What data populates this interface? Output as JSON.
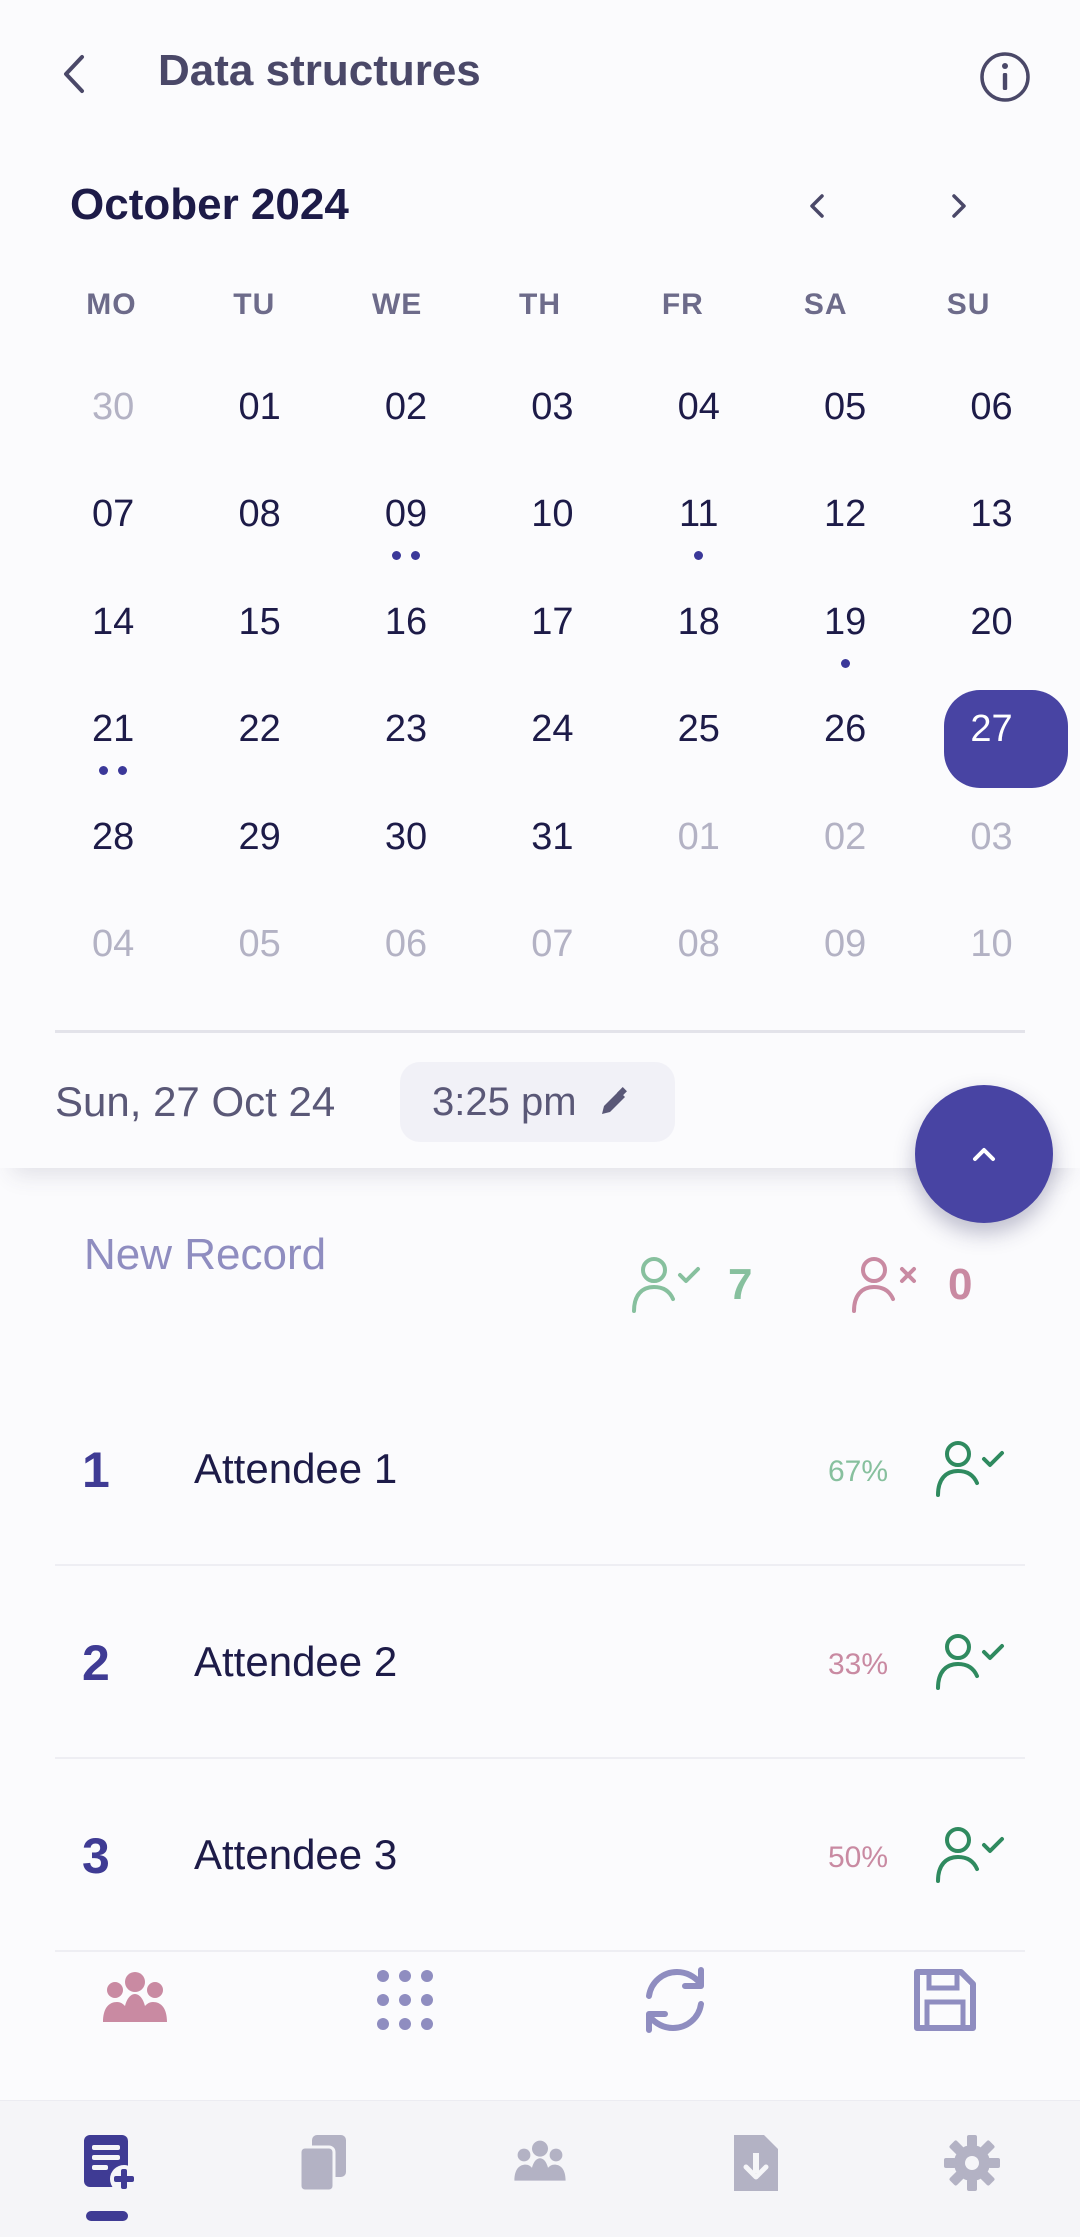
{
  "header": {
    "title": "Data structures"
  },
  "calendar": {
    "month_label": "October 2024",
    "weekdays": [
      "MO",
      "TU",
      "WE",
      "TH",
      "FR",
      "SA",
      "SU"
    ],
    "weeks": [
      [
        {
          "d": "30",
          "other": true
        },
        {
          "d": "01"
        },
        {
          "d": "02"
        },
        {
          "d": "03"
        },
        {
          "d": "04"
        },
        {
          "d": "05"
        },
        {
          "d": "06"
        }
      ],
      [
        {
          "d": "07"
        },
        {
          "d": "08"
        },
        {
          "d": "09",
          "dots": 2
        },
        {
          "d": "10"
        },
        {
          "d": "11",
          "dots": 1
        },
        {
          "d": "12"
        },
        {
          "d": "13"
        }
      ],
      [
        {
          "d": "14"
        },
        {
          "d": "15"
        },
        {
          "d": "16"
        },
        {
          "d": "17"
        },
        {
          "d": "18"
        },
        {
          "d": "19",
          "dots": 1
        },
        {
          "d": "20"
        }
      ],
      [
        {
          "d": "21",
          "dots": 2
        },
        {
          "d": "22"
        },
        {
          "d": "23"
        },
        {
          "d": "24"
        },
        {
          "d": "25"
        },
        {
          "d": "26"
        },
        {
          "d": "27",
          "selected": true
        }
      ],
      [
        {
          "d": "28"
        },
        {
          "d": "29"
        },
        {
          "d": "30"
        },
        {
          "d": "31"
        },
        {
          "d": "01",
          "other": true
        },
        {
          "d": "02",
          "other": true
        },
        {
          "d": "03",
          "other": true
        }
      ],
      [
        {
          "d": "04",
          "other": true
        },
        {
          "d": "05",
          "other": true
        },
        {
          "d": "06",
          "other": true
        },
        {
          "d": "07",
          "other": true
        },
        {
          "d": "08",
          "other": true
        },
        {
          "d": "09",
          "other": true
        },
        {
          "d": "10",
          "other": true
        }
      ]
    ],
    "selected_date_label": "Sun, 27 Oct 24",
    "time_label": "3:25 pm"
  },
  "summary": {
    "new_record_label": "New Record",
    "present_count": "7",
    "absent_count": "0"
  },
  "attendees": [
    {
      "index": "1",
      "name": "Attendee 1",
      "percent": "67%",
      "percent_color": "#87c09e"
    },
    {
      "index": "2",
      "name": "Attendee 2",
      "percent": "33%",
      "percent_color": "#c98aa2"
    },
    {
      "index": "3",
      "name": "Attendee 3",
      "percent": "50%",
      "percent_color": "#c98aa2"
    }
  ],
  "colors": {
    "accent": "#4844a3",
    "present": "#87c09e",
    "present_dark": "#2f8a5f",
    "absent": "#c98aa2",
    "muted": "#8f8dc0"
  },
  "icons": {
    "actions": [
      "group-icon",
      "grid-dots-icon",
      "refresh-icon",
      "save-icon"
    ],
    "tabs": [
      "new-record-icon",
      "records-icon",
      "groups-icon",
      "export-icon",
      "settings-icon"
    ],
    "active_tab": 0
  }
}
